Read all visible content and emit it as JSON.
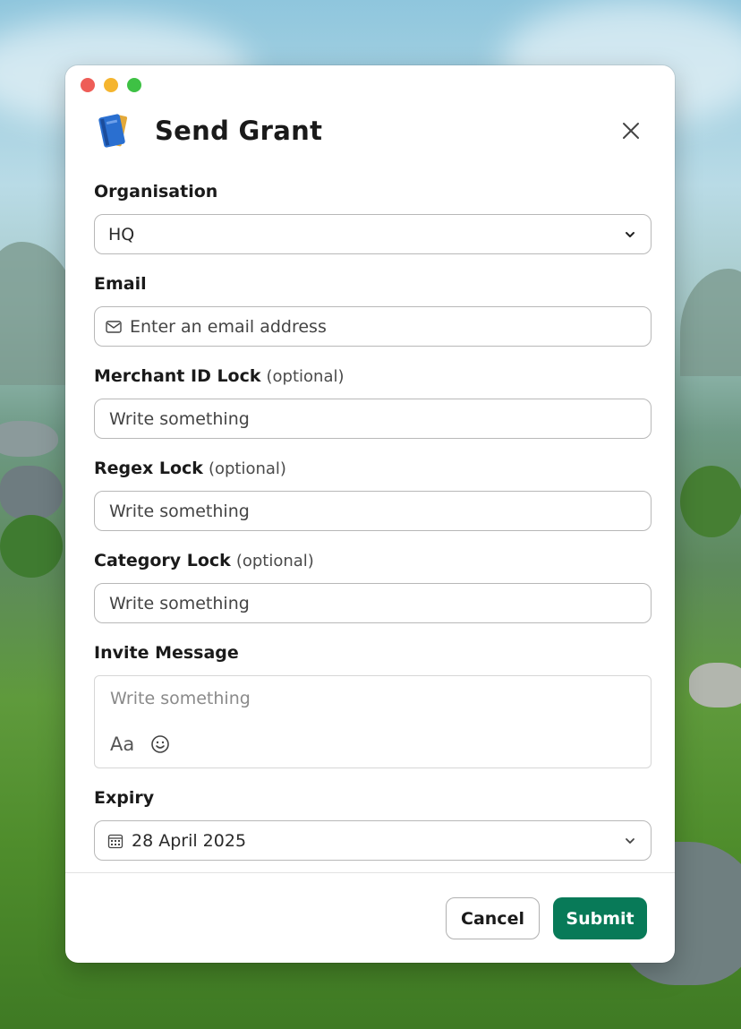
{
  "window": {
    "title": "Send Grant",
    "app_icon": "book-icon",
    "close_icon": "close-icon"
  },
  "form": {
    "organisation": {
      "label": "Organisation",
      "value": "HQ"
    },
    "email": {
      "label": "Email",
      "placeholder": "Enter an email address"
    },
    "merchant_id_lock": {
      "label": "Merchant ID Lock",
      "optional": "(optional)",
      "placeholder": "Write something"
    },
    "regex_lock": {
      "label": "Regex Lock",
      "optional": "(optional)",
      "placeholder": "Write something"
    },
    "category_lock": {
      "label": "Category Lock",
      "optional": "(optional)",
      "placeholder": "Write something"
    },
    "invite_message": {
      "label": "Invite Message",
      "placeholder": "Write something",
      "format_label": "Aa"
    },
    "expiry": {
      "label": "Expiry",
      "value": "28 April 2025"
    }
  },
  "footer": {
    "cancel_label": "Cancel",
    "submit_label": "Submit"
  },
  "colors": {
    "primary": "#087a58",
    "border": "#b8b8b8"
  }
}
